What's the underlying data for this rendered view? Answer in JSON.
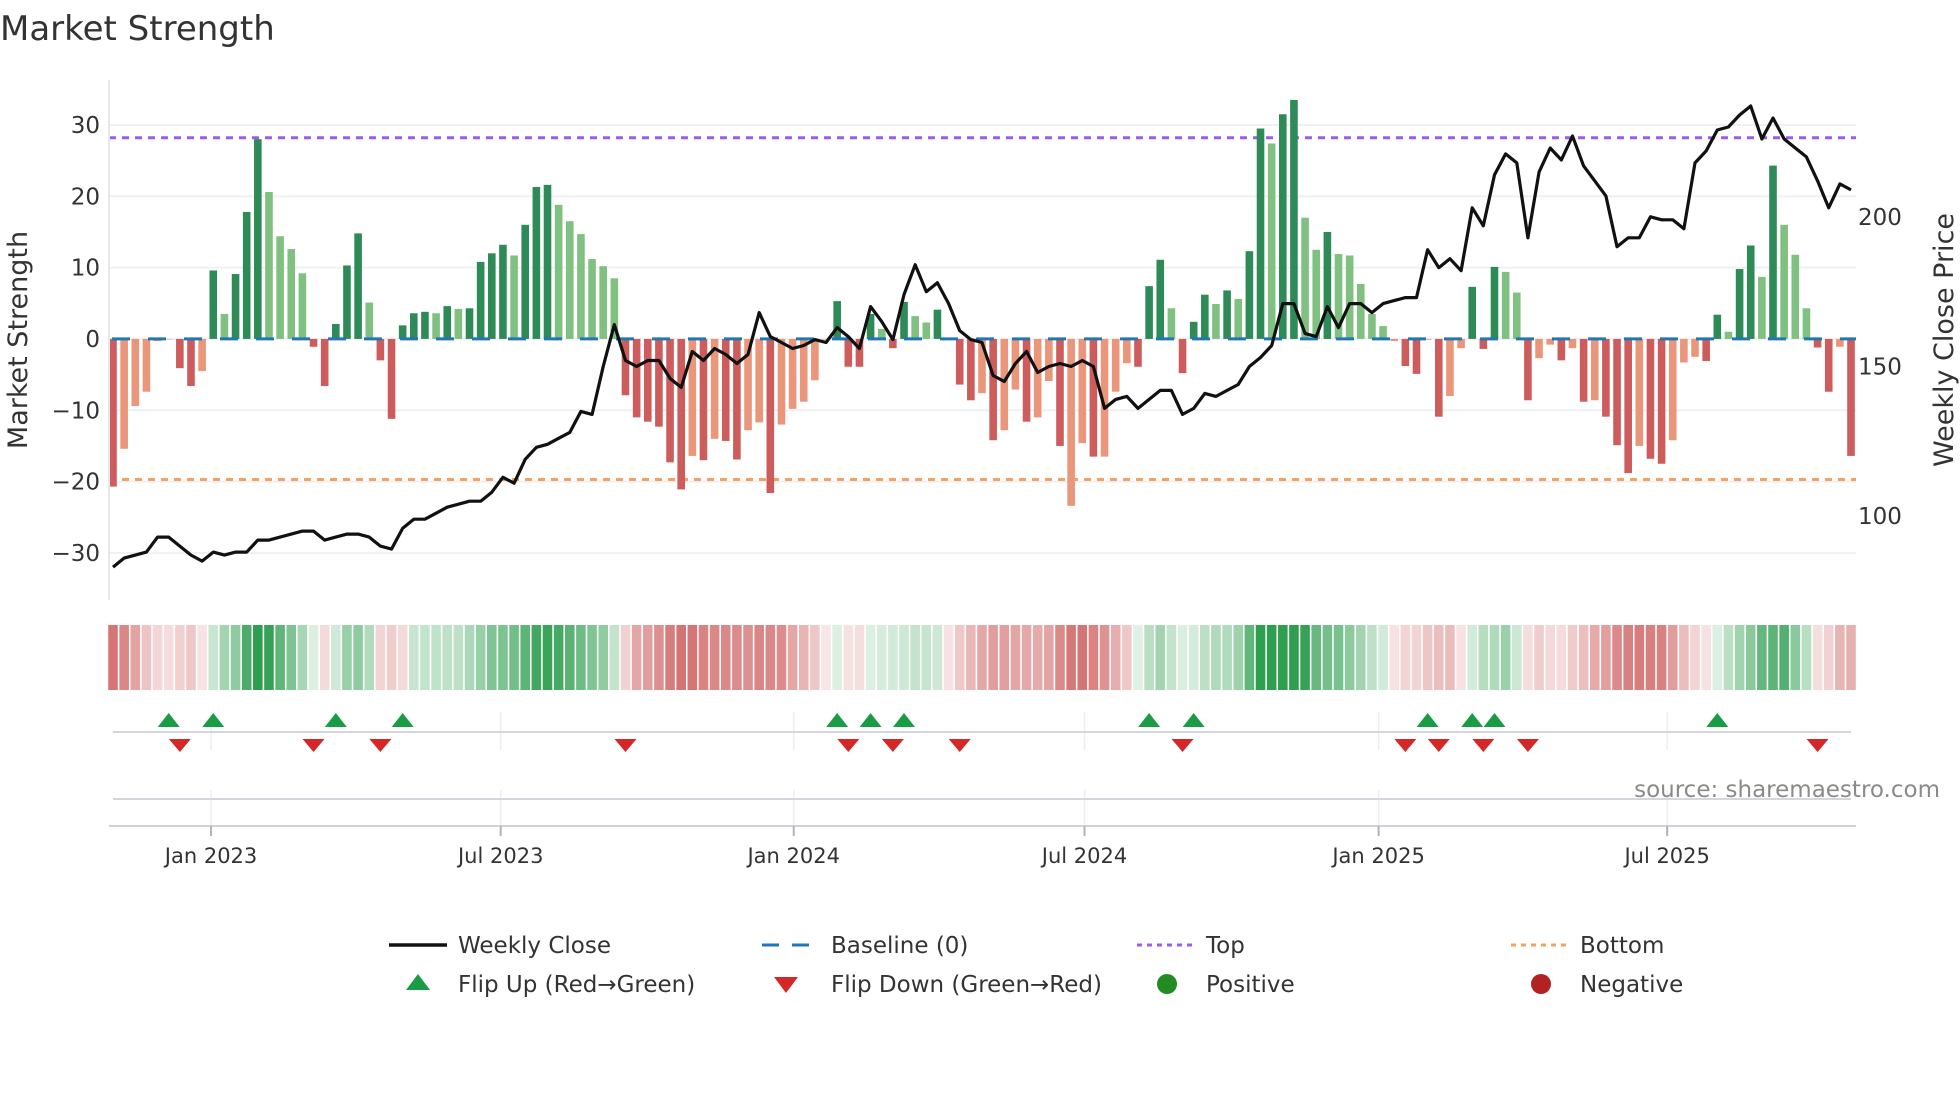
{
  "chart_data": {
    "type": "bar",
    "title": "Market Strength",
    "ylabel": "Market Strength",
    "y2label": "Weekly Close Price",
    "ylim": [
      -36.6,
      36.3
    ],
    "y2lim": [
      72,
      245.7
    ],
    "yticks": [
      30,
      20,
      10,
      0,
      -10,
      -20,
      -30
    ],
    "yticklabels": [
      "30",
      "20",
      "10",
      "0",
      "−10",
      "−20",
      "−30"
    ],
    "y2ticks": [
      200,
      150,
      100
    ],
    "y2ticklabels": [
      "200",
      "150",
      "100"
    ],
    "x_ticks": [
      {
        "label": "Jan 2023",
        "week": 8.8
      },
      {
        "label": "Jul 2023",
        "week": 34.8
      },
      {
        "label": "Jan 2024",
        "week": 61.1
      },
      {
        "label": "Jul 2024",
        "week": 87.2
      },
      {
        "label": "Jan 2025",
        "week": 113.6
      },
      {
        "label": "Jul 2025",
        "week": 139.5
      }
    ],
    "top_level": 28.2,
    "bottom_level": -19.7,
    "baseline": 0,
    "strength": [
      -20.7,
      -15.4,
      -9.4,
      -7.4,
      -0.3,
      0,
      -4.1,
      -6.6,
      -4.5,
      9.6,
      3.5,
      9.1,
      17.8,
      28,
      20.6,
      14.4,
      12.6,
      9.2,
      -1.1,
      -6.6,
      2.1,
      10.3,
      14.8,
      5.1,
      -3,
      -11.2,
      1.9,
      3.6,
      3.8,
      3.6,
      4.6,
      4.2,
      4.3,
      10.8,
      12.0,
      13.2,
      11.7,
      16,
      21.3,
      21.6,
      18.8,
      16.5,
      14.7,
      11.2,
      10.2,
      8.5,
      -7.9,
      -11,
      -11.6,
      -12.3,
      -17.3,
      -21.1,
      -16.4,
      -17,
      -14,
      -14.3,
      -16.9,
      -12.8,
      -11.7,
      -21.6,
      -12,
      -9.8,
      -8.8,
      -5.8,
      0,
      5.3,
      -3.9,
      -3.9,
      3.5,
      1.4,
      -1.3,
      5.2,
      3.2,
      2.3,
      4.1,
      0,
      -6.4,
      -8.6,
      -7.6,
      -14.2,
      -12.8,
      -7.1,
      -11.6,
      -11,
      -5.9,
      -15,
      -23.4,
      -14.6,
      -16.5,
      -16.5,
      -7.4,
      -3.4,
      -3.9,
      7.4,
      11.1,
      4.3,
      -4.8,
      2.4,
      6.2,
      4.9,
      6.8,
      5.6,
      12.3,
      29.5,
      27.4,
      31.5,
      33.5,
      17,
      12.5,
      15,
      11.9,
      11.7,
      7.7,
      3.5,
      1.8,
      -0.3,
      -3.8,
      -4.9,
      0,
      -10.9,
      -8,
      -1.3,
      7.3,
      -1.4,
      10.1,
      9.4,
      6.5,
      -8.6,
      -2.7,
      -0.8,
      -3,
      -1.3,
      -8.8,
      -8.6,
      -10.9,
      -14.9,
      -18.8,
      -15,
      -16.8,
      -17.5,
      -14.2,
      -3.3,
      -2.5,
      -3.1,
      3.4,
      1,
      9.8,
      13.1,
      8.7,
      24.3,
      16,
      11.8,
      4.3,
      -1.2,
      -7.4,
      -1.1,
      -16.4
    ],
    "shade": "RSSSSSRRSDLDDDLLLLRRDDDLRRDDDLDLDDDDLDDDLLLLLLRRRRRRSRSRRSSRSSSSSDRRDLRDLLDRRRSRSSRSSRSSRSSSRDDLRDDLDLDDLDDLLDLLLLLSRRRRSSDRDLLRSSRSRSRRRSRRSSSRDLDDLDLLLRRSR",
    "shade_colors": {
      "D": "#2e8b57",
      "L": "#80c080",
      "R": "#cd5c5c",
      "S": "#e9967a"
    },
    "weekly_close": [
      83,
      86,
      87,
      88,
      93,
      93,
      90,
      87,
      85,
      88,
      87,
      88,
      88,
      92,
      92,
      93,
      94,
      95,
      95,
      92,
      93,
      94,
      94,
      93,
      90,
      89,
      96,
      99,
      99,
      101,
      103,
      104,
      105,
      105,
      108,
      113,
      111,
      119,
      123,
      124,
      126,
      128,
      135,
      134,
      150,
      164,
      152,
      150,
      152,
      152,
      146,
      143,
      155,
      152,
      156,
      154,
      151,
      154,
      168,
      160,
      158,
      156,
      157,
      159,
      158,
      163,
      160,
      156,
      170,
      165,
      159,
      174,
      184,
      175,
      178,
      171,
      162,
      159,
      158,
      147,
      145,
      151,
      155,
      148,
      150,
      151,
      150,
      152,
      150,
      136,
      139,
      140,
      136,
      139,
      142,
      142,
      134,
      136,
      141,
      140,
      142,
      144,
      150,
      153,
      157,
      171,
      171,
      161,
      160,
      170,
      163,
      171,
      171,
      168,
      171,
      172,
      173,
      173,
      189,
      183,
      186,
      182,
      203,
      197,
      214,
      221,
      218,
      193,
      215,
      223,
      219,
      227,
      217,
      212,
      207,
      190,
      193,
      193,
      200,
      199,
      199,
      196,
      218,
      222,
      229,
      230,
      234,
      237,
      226,
      233,
      226,
      223,
      220,
      212,
      203,
      211,
      209
    ],
    "flip_up_weeks": [
      6,
      10,
      21,
      27,
      66,
      69,
      72,
      94,
      98,
      119,
      123,
      125,
      145
    ],
    "flip_down_weeks": [
      7,
      19,
      25,
      47,
      67,
      71,
      77,
      97,
      117,
      120,
      124,
      128,
      154
    ],
    "colors": {
      "close": "#111111",
      "baseline": "#1f77b4",
      "top": "#9b5de5",
      "bottom": "#f4a261",
      "flip_up": "#1a9c45",
      "flip_down": "#d62728",
      "positive": "#228b22",
      "negative": "#b22222",
      "heat_pos": "#2e9e4f",
      "heat_neg": "#cd5c5c"
    },
    "legend": [
      {
        "key": "close",
        "label": "Weekly Close"
      },
      {
        "key": "baseline",
        "label": "Baseline (0)"
      },
      {
        "key": "top",
        "label": "Top"
      },
      {
        "key": "bottom",
        "label": "Bottom"
      },
      {
        "key": "flip_up",
        "label": "Flip Up (Red→Green)"
      },
      {
        "key": "flip_down",
        "label": "Flip Down (Green→Red)"
      },
      {
        "key": "positive",
        "label": "Positive"
      },
      {
        "key": "negative",
        "label": "Negative"
      }
    ],
    "legend_placement": "bottom"
  },
  "source": "source: sharemaestro.com"
}
